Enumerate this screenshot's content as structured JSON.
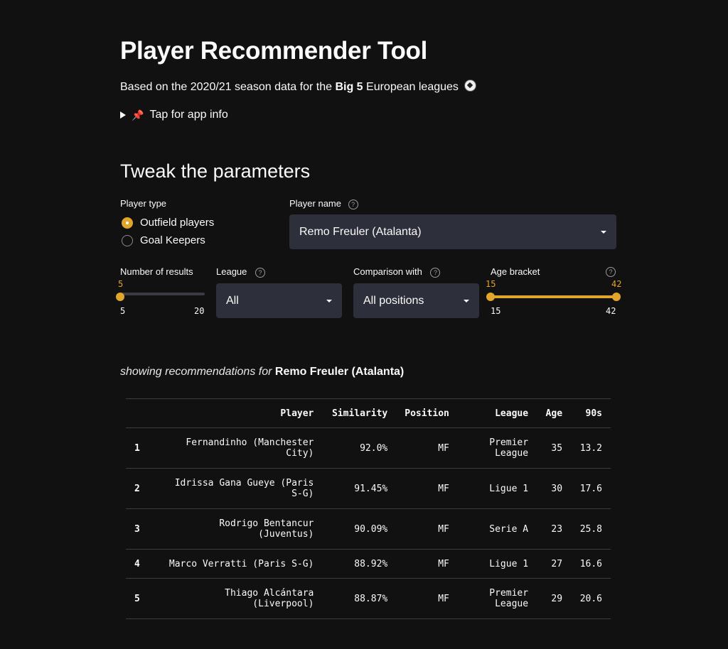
{
  "header": {
    "title": "Player Recommender Tool",
    "subtitle_pre": "Based on the 2020/21 season data for the ",
    "subtitle_bold": "Big 5",
    "subtitle_post": " European leagues",
    "expander_label": "Tap for app info"
  },
  "params": {
    "heading": "Tweak the parameters",
    "player_type": {
      "label": "Player type",
      "options": [
        "Outfield players",
        "Goal Keepers"
      ],
      "selected": "Outfield players"
    },
    "player_name": {
      "label": "Player name",
      "value": "Remo Freuler (Atalanta)"
    },
    "num_results": {
      "label": "Number of results",
      "value": "5",
      "min": "5",
      "max": "20"
    },
    "league": {
      "label": "League",
      "value": "All"
    },
    "comparison": {
      "label": "Comparison with",
      "value": "All positions"
    },
    "age": {
      "label": "Age bracket",
      "low": "15",
      "high": "42",
      "min": "15",
      "max": "42"
    }
  },
  "results": {
    "showing_pre": "showing recommendations for",
    "showing_player": "Remo Freuler (Atalanta)",
    "columns": [
      "",
      "Player",
      "Similarity",
      "Position",
      "League",
      "Age",
      "90s"
    ],
    "rows": [
      {
        "rank": "1",
        "player1": "Fernandinho (Manchester",
        "player2": "City)",
        "similarity": "92.0%",
        "position": "MF",
        "league1": "Premier",
        "league2": "League",
        "age": "35",
        "nineties": "13.2"
      },
      {
        "rank": "2",
        "player1": "Idrissa Gana Gueye (Paris",
        "player2": "S-G)",
        "similarity": "91.45%",
        "position": "MF",
        "league1": "Ligue 1",
        "league2": "",
        "age": "30",
        "nineties": "17.6"
      },
      {
        "rank": "3",
        "player1": "Rodrigo Bentancur",
        "player2": "(Juventus)",
        "similarity": "90.09%",
        "position": "MF",
        "league1": "Serie A",
        "league2": "",
        "age": "23",
        "nineties": "25.8"
      },
      {
        "rank": "4",
        "player1": "Marco Verratti (Paris S-G)",
        "player2": "",
        "similarity": "88.92%",
        "position": "MF",
        "league1": "Ligue 1",
        "league2": "",
        "age": "27",
        "nineties": "16.6"
      },
      {
        "rank": "5",
        "player1": "Thiago Alcántara",
        "player2": "(Liverpool)",
        "similarity": "88.87%",
        "position": "MF",
        "league1": "Premier",
        "league2": "League",
        "age": "29",
        "nineties": "20.6"
      }
    ]
  }
}
